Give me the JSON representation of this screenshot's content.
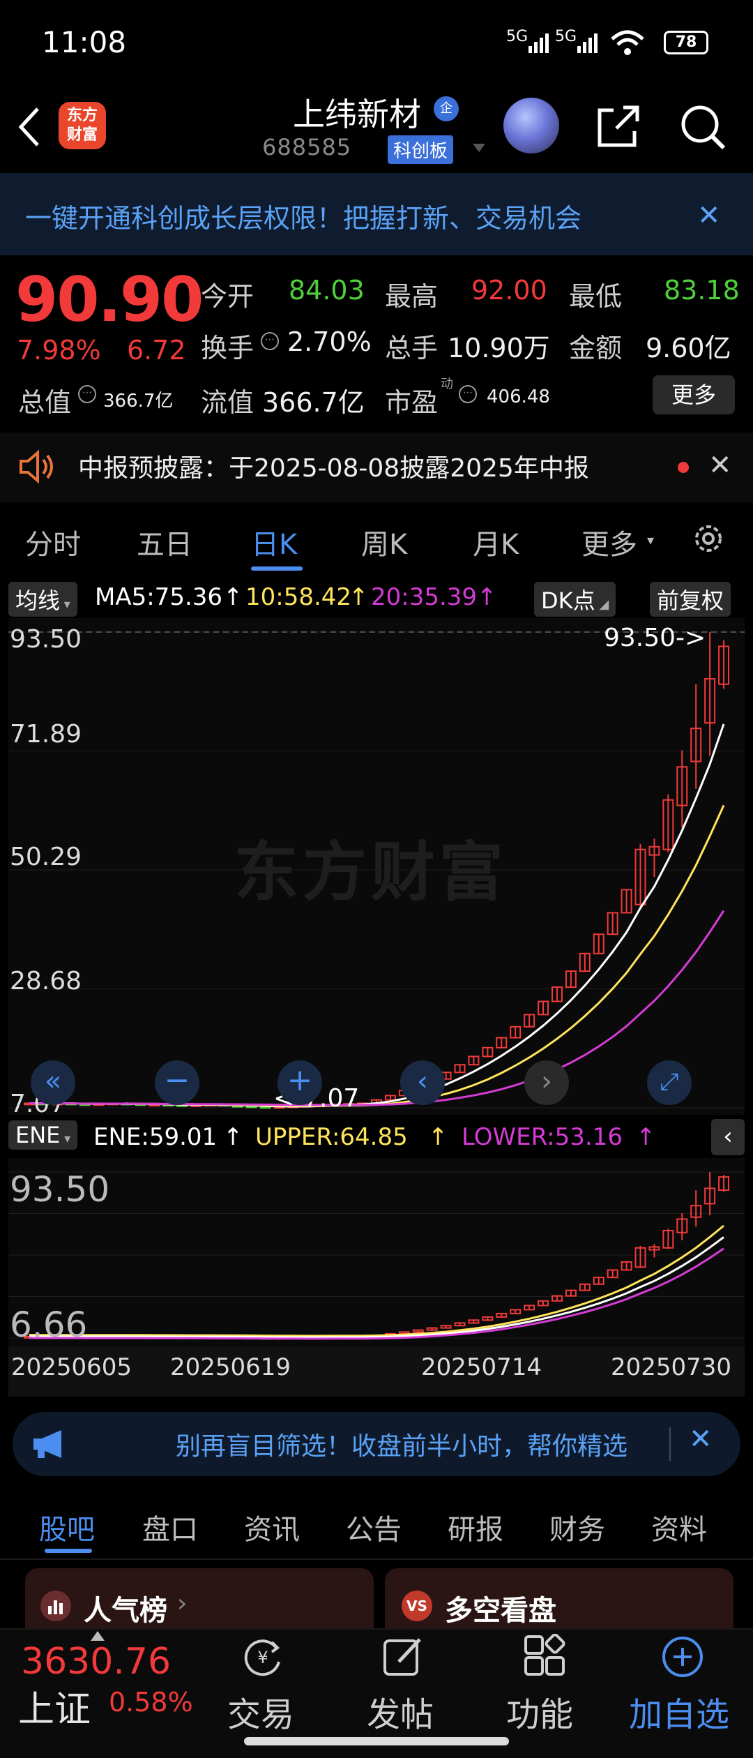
{
  "status_bar": {
    "time": "11:08",
    "signal1": "5G",
    "signal2": "5G",
    "battery": "78"
  },
  "header": {
    "logo_line1": "东方",
    "logo_line2": "财富",
    "stock_name": "上纬新材",
    "verified_badge": "企",
    "stock_code": "688585",
    "board_tag": "科创板"
  },
  "banner": {
    "text": "一键开通科创成长层权限！把握打新、交易机会"
  },
  "quote": {
    "price": "90.90",
    "change_pct": "7.98%",
    "change_amt": "6.72",
    "open_label": "今开",
    "open_value": "84.03",
    "high_label": "最高",
    "high_value": "92.00",
    "low_label": "最低",
    "low_value": "83.18",
    "turnover_label": "换手",
    "turnover_value": "2.70%",
    "volume_label": "总手",
    "volume_value": "10.90万",
    "amount_label": "金额",
    "amount_value": "9.60亿",
    "mktcap_label": "总值",
    "mktcap_value": "366.7亿",
    "float_label": "流值",
    "float_value": "366.7亿",
    "pe_label": "市盈",
    "pe_sup": "动",
    "pe_value": "406.48",
    "more_label": "更多"
  },
  "disclosure": {
    "text": "中报预披露：于2025-08-08披露2025年中报"
  },
  "period_tabs": [
    "分时",
    "五日",
    "日K",
    "周K",
    "月K",
    "更多"
  ],
  "ma_row": {
    "selector": "均线",
    "ma5": "MA5:75.36",
    "ma10": "10:58.42",
    "ma20": "20:35.39",
    "dk_label": "DK点",
    "adjust_label": "前复权"
  },
  "main_chart": {
    "y_labels": [
      "93.50",
      "71.89",
      "50.29",
      "28.68",
      "7.07"
    ],
    "max_marker": "93.50->",
    "min_marker": "<-7.07",
    "watermark": "东方财富"
  },
  "ene_row": {
    "selector": "ENE",
    "ene": "ENE:59.01",
    "upper": "UPPER:64.85",
    "lower": "LOWER:53.16"
  },
  "sub_chart": {
    "y_top": "93.50",
    "y_bottom": "6.66"
  },
  "date_axis": [
    "20250605",
    "20250619",
    "20250714",
    "20250730"
  ],
  "promo": {
    "text": "别再盲目筛选！收盘前半小时，帮你精选"
  },
  "info_tabs": [
    "股吧",
    "盘口",
    "资讯",
    "公告",
    "研报",
    "财务",
    "资料"
  ],
  "cards": {
    "left": "人气榜",
    "right": "多空看盘"
  },
  "footer": {
    "index_value": "3630.76",
    "index_name": "上证",
    "index_pct": "0.58%",
    "trade": "交易",
    "post": "发帖",
    "features": "功能",
    "watchlist": "加自选"
  },
  "colors": {
    "up": "#f23a3a",
    "down": "#4fd13a",
    "accent": "#4b8ef0",
    "ma10": "#ffe45c",
    "ma20": "#d63bd6"
  },
  "chart_data": {
    "type": "candlestick",
    "ylim": [
      7.07,
      93.5
    ],
    "candles": [
      [
        7.8,
        8.0,
        7.6,
        7.9
      ],
      [
        7.9,
        8.1,
        7.7,
        7.8
      ],
      [
        7.8,
        8.0,
        7.6,
        7.9
      ],
      [
        7.9,
        8.0,
        7.7,
        7.8
      ],
      [
        7.8,
        8.0,
        7.6,
        7.7
      ],
      [
        7.7,
        7.9,
        7.5,
        7.8
      ],
      [
        7.8,
        8.0,
        7.6,
        7.9
      ],
      [
        7.9,
        8.1,
        7.7,
        7.8
      ],
      [
        7.8,
        7.9,
        7.5,
        7.6
      ],
      [
        7.6,
        7.8,
        7.4,
        7.7
      ],
      [
        7.7,
        7.9,
        7.5,
        7.6
      ],
      [
        7.6,
        7.8,
        7.3,
        7.5
      ],
      [
        7.5,
        7.7,
        7.3,
        7.6
      ],
      [
        7.6,
        7.8,
        7.4,
        7.7
      ],
      [
        7.7,
        7.8,
        7.4,
        7.5
      ],
      [
        7.5,
        7.7,
        7.2,
        7.4
      ],
      [
        7.4,
        7.6,
        7.1,
        7.3
      ],
      [
        7.3,
        7.5,
        7.07,
        7.2
      ],
      [
        7.2,
        7.4,
        7.1,
        7.3
      ],
      [
        7.3,
        7.5,
        7.2,
        7.4
      ],
      [
        7.4,
        7.6,
        7.2,
        7.5
      ],
      [
        7.5,
        7.7,
        7.3,
        7.6
      ],
      [
        7.6,
        7.8,
        7.4,
        7.7
      ],
      [
        7.7,
        7.9,
        7.5,
        7.8
      ],
      [
        7.8,
        8.0,
        7.6,
        7.9
      ],
      [
        7.9,
        8.6,
        7.8,
        8.5
      ],
      [
        8.5,
        9.4,
        8.5,
        9.3
      ],
      [
        9.3,
        10.3,
        9.3,
        10.2
      ],
      [
        10.2,
        11.2,
        10.2,
        11.2
      ],
      [
        11.2,
        12.3,
        11.2,
        12.3
      ],
      [
        12.3,
        13.6,
        12.3,
        13.5
      ],
      [
        13.5,
        14.9,
        13.5,
        14.9
      ],
      [
        14.9,
        16.4,
        14.9,
        16.4
      ],
      [
        16.4,
        18.0,
        16.4,
        18.0
      ],
      [
        18.0,
        19.8,
        18.0,
        19.8
      ],
      [
        19.8,
        21.8,
        19.8,
        21.8
      ],
      [
        21.8,
        24.0,
        21.8,
        24.0
      ],
      [
        24.0,
        26.4,
        24.0,
        26.4
      ],
      [
        26.4,
        29.0,
        26.4,
        29.0
      ],
      [
        29.0,
        31.9,
        29.0,
        31.9
      ],
      [
        31.9,
        35.1,
        31.9,
        35.1
      ],
      [
        35.1,
        38.6,
        35.1,
        38.6
      ],
      [
        38.6,
        42.5,
        38.6,
        42.5
      ],
      [
        42.5,
        46.7,
        42.5,
        46.7
      ],
      [
        44.0,
        55.0,
        43.5,
        54.0
      ],
      [
        53.0,
        56.0,
        49.0,
        54.5
      ],
      [
        54.0,
        64.0,
        53.5,
        63.0
      ],
      [
        62.0,
        72.0,
        58.0,
        69.0
      ],
      [
        70.0,
        84.0,
        65.0,
        76.0
      ],
      [
        77.0,
        93.5,
        71.0,
        85.0
      ],
      [
        84.03,
        92.0,
        83.18,
        90.9
      ]
    ],
    "ma5_last": 75.36,
    "ma10_last": 58.42,
    "ma20_last": 35.39,
    "ene_last": 59.01,
    "upper_last": 64.85,
    "lower_last": 53.16
  }
}
